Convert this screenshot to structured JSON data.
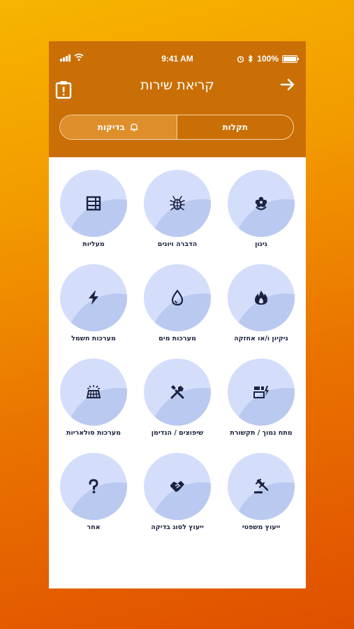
{
  "status_bar": {
    "time": "9:41 AM",
    "battery": "100%"
  },
  "header": {
    "title": "קריאת שירות"
  },
  "segments": {
    "faults": "תקלות",
    "inspections": "בדיקות",
    "active": "inspections"
  },
  "services": [
    {
      "label": "גינון",
      "icon": "flower-icon"
    },
    {
      "label": "הדברה ויונים",
      "icon": "bug-icon"
    },
    {
      "label": "מעליות",
      "icon": "elevator-icon"
    },
    {
      "label": "ניקיון ו/או אחזקה",
      "icon": "fire-icon"
    },
    {
      "label": "מערכות מים",
      "icon": "water-drop-icon"
    },
    {
      "label": "מערכות חשמל",
      "icon": "lightning-icon"
    },
    {
      "label": "מתח נמוך / תקשורת",
      "icon": "low-voltage-icon"
    },
    {
      "label": "שיפוצים / הנדימן",
      "icon": "tools-icon"
    },
    {
      "label": "מערכות סולאריות",
      "icon": "solar-panel-icon"
    },
    {
      "label": "ייעוץ משפטי",
      "icon": "gavel-icon"
    },
    {
      "label": "ייעוץ לסוג בדיקה",
      "icon": "handshake-icon"
    },
    {
      "label": "אחר",
      "icon": "question-icon"
    }
  ],
  "colors": {
    "header": "#c96f05",
    "circle": "#d4defb",
    "icon": "#1c2340"
  }
}
